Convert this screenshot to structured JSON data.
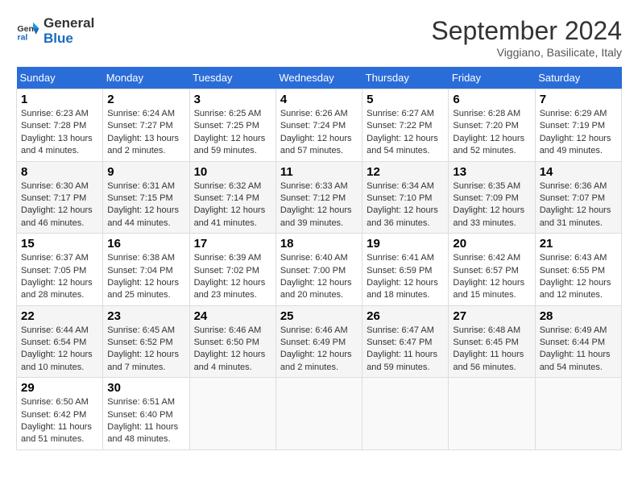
{
  "header": {
    "logo_line1": "General",
    "logo_line2": "Blue",
    "month": "September 2024",
    "location": "Viggiano, Basilicate, Italy"
  },
  "days_of_week": [
    "Sunday",
    "Monday",
    "Tuesday",
    "Wednesday",
    "Thursday",
    "Friday",
    "Saturday"
  ],
  "weeks": [
    [
      {
        "day": "1",
        "info": "Sunrise: 6:23 AM\nSunset: 7:28 PM\nDaylight: 13 hours\nand 4 minutes."
      },
      {
        "day": "2",
        "info": "Sunrise: 6:24 AM\nSunset: 7:27 PM\nDaylight: 13 hours\nand 2 minutes."
      },
      {
        "day": "3",
        "info": "Sunrise: 6:25 AM\nSunset: 7:25 PM\nDaylight: 12 hours\nand 59 minutes."
      },
      {
        "day": "4",
        "info": "Sunrise: 6:26 AM\nSunset: 7:24 PM\nDaylight: 12 hours\nand 57 minutes."
      },
      {
        "day": "5",
        "info": "Sunrise: 6:27 AM\nSunset: 7:22 PM\nDaylight: 12 hours\nand 54 minutes."
      },
      {
        "day": "6",
        "info": "Sunrise: 6:28 AM\nSunset: 7:20 PM\nDaylight: 12 hours\nand 52 minutes."
      },
      {
        "day": "7",
        "info": "Sunrise: 6:29 AM\nSunset: 7:19 PM\nDaylight: 12 hours\nand 49 minutes."
      }
    ],
    [
      {
        "day": "8",
        "info": "Sunrise: 6:30 AM\nSunset: 7:17 PM\nDaylight: 12 hours\nand 46 minutes."
      },
      {
        "day": "9",
        "info": "Sunrise: 6:31 AM\nSunset: 7:15 PM\nDaylight: 12 hours\nand 44 minutes."
      },
      {
        "day": "10",
        "info": "Sunrise: 6:32 AM\nSunset: 7:14 PM\nDaylight: 12 hours\nand 41 minutes."
      },
      {
        "day": "11",
        "info": "Sunrise: 6:33 AM\nSunset: 7:12 PM\nDaylight: 12 hours\nand 39 minutes."
      },
      {
        "day": "12",
        "info": "Sunrise: 6:34 AM\nSunset: 7:10 PM\nDaylight: 12 hours\nand 36 minutes."
      },
      {
        "day": "13",
        "info": "Sunrise: 6:35 AM\nSunset: 7:09 PM\nDaylight: 12 hours\nand 33 minutes."
      },
      {
        "day": "14",
        "info": "Sunrise: 6:36 AM\nSunset: 7:07 PM\nDaylight: 12 hours\nand 31 minutes."
      }
    ],
    [
      {
        "day": "15",
        "info": "Sunrise: 6:37 AM\nSunset: 7:05 PM\nDaylight: 12 hours\nand 28 minutes."
      },
      {
        "day": "16",
        "info": "Sunrise: 6:38 AM\nSunset: 7:04 PM\nDaylight: 12 hours\nand 25 minutes."
      },
      {
        "day": "17",
        "info": "Sunrise: 6:39 AM\nSunset: 7:02 PM\nDaylight: 12 hours\nand 23 minutes."
      },
      {
        "day": "18",
        "info": "Sunrise: 6:40 AM\nSunset: 7:00 PM\nDaylight: 12 hours\nand 20 minutes."
      },
      {
        "day": "19",
        "info": "Sunrise: 6:41 AM\nSunset: 6:59 PM\nDaylight: 12 hours\nand 18 minutes."
      },
      {
        "day": "20",
        "info": "Sunrise: 6:42 AM\nSunset: 6:57 PM\nDaylight: 12 hours\nand 15 minutes."
      },
      {
        "day": "21",
        "info": "Sunrise: 6:43 AM\nSunset: 6:55 PM\nDaylight: 12 hours\nand 12 minutes."
      }
    ],
    [
      {
        "day": "22",
        "info": "Sunrise: 6:44 AM\nSunset: 6:54 PM\nDaylight: 12 hours\nand 10 minutes."
      },
      {
        "day": "23",
        "info": "Sunrise: 6:45 AM\nSunset: 6:52 PM\nDaylight: 12 hours\nand 7 minutes."
      },
      {
        "day": "24",
        "info": "Sunrise: 6:46 AM\nSunset: 6:50 PM\nDaylight: 12 hours\nand 4 minutes."
      },
      {
        "day": "25",
        "info": "Sunrise: 6:46 AM\nSunset: 6:49 PM\nDaylight: 12 hours\nand 2 minutes."
      },
      {
        "day": "26",
        "info": "Sunrise: 6:47 AM\nSunset: 6:47 PM\nDaylight: 11 hours\nand 59 minutes."
      },
      {
        "day": "27",
        "info": "Sunrise: 6:48 AM\nSunset: 6:45 PM\nDaylight: 11 hours\nand 56 minutes."
      },
      {
        "day": "28",
        "info": "Sunrise: 6:49 AM\nSunset: 6:44 PM\nDaylight: 11 hours\nand 54 minutes."
      }
    ],
    [
      {
        "day": "29",
        "info": "Sunrise: 6:50 AM\nSunset: 6:42 PM\nDaylight: 11 hours\nand 51 minutes."
      },
      {
        "day": "30",
        "info": "Sunrise: 6:51 AM\nSunset: 6:40 PM\nDaylight: 11 hours\nand 48 minutes."
      },
      {
        "day": "",
        "info": ""
      },
      {
        "day": "",
        "info": ""
      },
      {
        "day": "",
        "info": ""
      },
      {
        "day": "",
        "info": ""
      },
      {
        "day": "",
        "info": ""
      }
    ]
  ]
}
